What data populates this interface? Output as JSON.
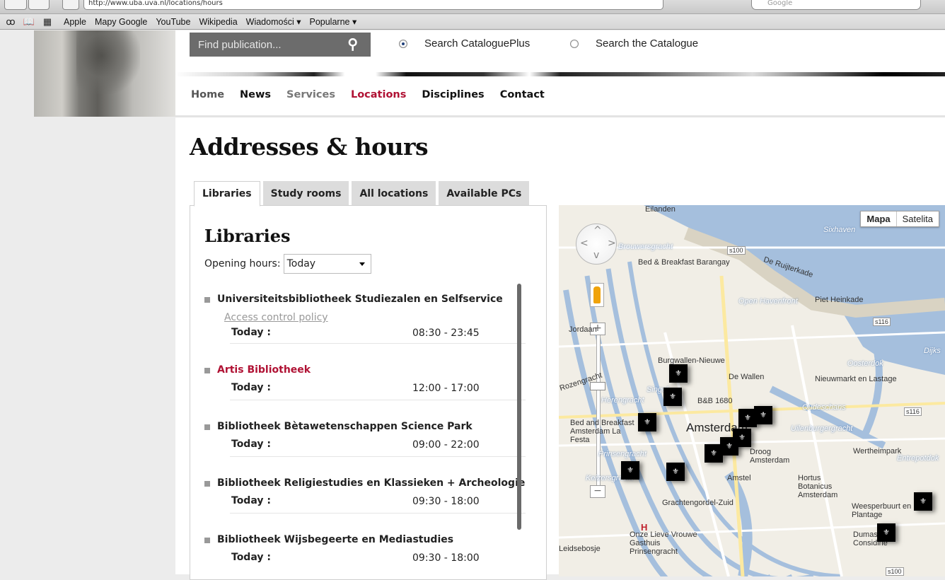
{
  "browser": {
    "url": "http://www.uba.uva.nl/locations/hours",
    "search_placeholder": "Google",
    "bookmarks": [
      "Apple",
      "Mapy Google",
      "YouTube",
      "Wikipedia",
      "Wiadomości ▾",
      "Popularne ▾"
    ]
  },
  "header": {
    "search_placeholder": "Find publication...",
    "radio1": "Search CataloguePlus",
    "radio2": "Search the Catalogue"
  },
  "nav": {
    "home": "Home",
    "news": "News",
    "services": "Services",
    "locations": "Locations",
    "disciplines": "Disciplines",
    "contact": "Contact"
  },
  "page": {
    "title": "Addresses & hours",
    "tabs": [
      "Libraries",
      "Study rooms",
      "All locations",
      "Available PCs"
    ]
  },
  "panel": {
    "heading": "Libraries",
    "hours_label": "Opening hours:",
    "hours_value": "Today",
    "libraries": [
      {
        "name": "Universiteitsbibliotheek Studiezalen en Selfservice",
        "link": "Access control policy",
        "day": "Today :",
        "time": "08:30 - 23:45"
      },
      {
        "name": "Artis Bibliotheek",
        "day": "Today :",
        "time": "12:00 - 17:00"
      },
      {
        "name": "Bibliotheek Bètawetenschappen Science Park",
        "day": "Today :",
        "time": "09:00 - 22:00"
      },
      {
        "name": "Bibliotheek Religiestudies en Klassieken + Archeologie",
        "day": "Today :",
        "time": "09:30 - 18:00"
      },
      {
        "name": "Bibliotheek Wijsbegeerte en Mediastudies",
        "day": "Today :",
        "time": "09:30 - 18:00"
      }
    ]
  },
  "map": {
    "type_map": "Mapa",
    "type_satellite": "Satelita",
    "labels": [
      "Brouwersgracht",
      "Bed & Breakfast Barangay",
      "De Ruijterkade",
      "Open Havenfront",
      "Piet Heinkade",
      "Burgwallen-Nieuwe",
      "De Wallen",
      "Nieuwmarkt en Lastage",
      "Oosterdok",
      "Rozengracht",
      "Herengracht",
      "B&B 1680",
      "Oudeschans",
      "Amsterdam",
      "Uilenburgergracht",
      "Bed and Breakfast Amsterdam La Festa",
      "Prinsengracht",
      "Droog Amsterdam",
      "Wertheimpark",
      "Entrepotdok",
      "Keizersgracht",
      "Amstel",
      "Hortus Botanicus Amsterdam",
      "Grachtengordel-Zuid",
      "Weesperbuurt en Plantage",
      "Onze Lieve Vrouwe Gasthuis Prinsengracht",
      "Dumas & Considine",
      "Leidsebosje",
      "Sixhaven",
      "Eilanden",
      "Dijks",
      "Jordaan",
      "Singel"
    ],
    "roads": [
      "s100",
      "s116",
      "s116",
      "s100"
    ]
  }
}
